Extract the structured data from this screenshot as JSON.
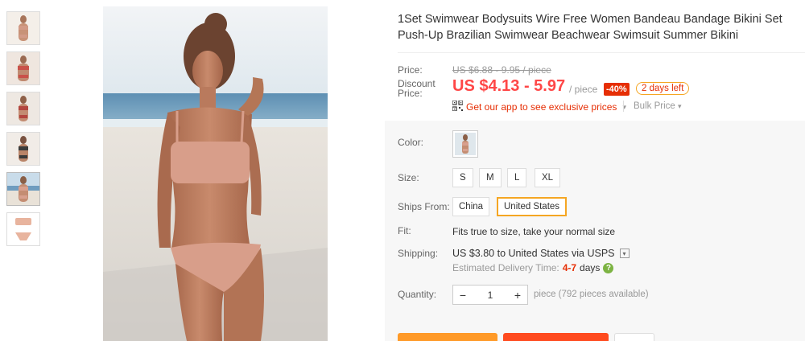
{
  "product": {
    "title": "1Set Swimwear Bodysuits Wire Free Women Bandeau Bandage Bikini Set Push-Up Brazilian Swimwear Beachwear Swimsuit Summer Bikini"
  },
  "price": {
    "label": "Price:",
    "original": "US $6.88 - 9.95 / piece",
    "discount_label_1": "Discount",
    "discount_label_2": "Price:",
    "current": "US $4.13 - 5.97",
    "per_piece": "/ piece",
    "discount_pct": "-40%",
    "days_left": "2 days left",
    "app_promo": "Get our app to see exclusive prices",
    "bulk_price": "Bulk Price"
  },
  "options": {
    "color_label": "Color:",
    "size_label": "Size:",
    "sizes": [
      "S",
      "M",
      "L",
      "XL"
    ],
    "ships_from_label": "Ships From:",
    "ships_from": [
      "China",
      "United States"
    ],
    "ships_from_selected": "United States",
    "fit_label": "Fit:",
    "fit_text": "Fits true to size, take your normal size",
    "shipping_label": "Shipping:",
    "shipping_text": "US $3.80 to United States via USPS",
    "delivery_label": "Estimated Delivery Time:",
    "delivery_days": "4-7",
    "delivery_unit": "days",
    "quantity_label": "Quantity:",
    "quantity_value": "1",
    "quantity_minus": "−",
    "quantity_plus": "+",
    "quantity_note": "piece (792 pieces available)"
  },
  "icons": {
    "qr": "qr-code-icon",
    "help": "question-icon",
    "help_glyph": "?",
    "caret": "▾"
  },
  "colors": {
    "accent": "#ff4747",
    "selected_border": "#f5a623",
    "buy_now": "#ff9a28",
    "add_to_cart": "#ff4b1f"
  }
}
